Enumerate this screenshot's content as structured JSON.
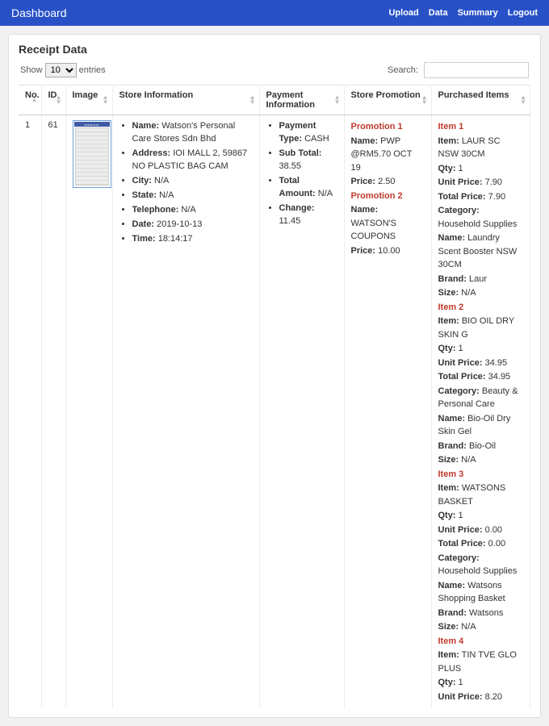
{
  "navbar": {
    "brand": "Dashboard",
    "menu": [
      "Upload",
      "Data",
      "Summary",
      "Logout"
    ]
  },
  "section_title": "Receipt Data",
  "table_controls": {
    "show_label_pre": "Show",
    "show_label_post": "entries",
    "show_value": "10",
    "search_label": "Search:"
  },
  "columns": {
    "no": "No.",
    "id": "ID",
    "image": "Image",
    "store": "Store Information",
    "payment": "Payment Information",
    "promo": "Store Promotion",
    "items": "Purchased Items"
  },
  "row": {
    "no": "1",
    "id": "61",
    "store": {
      "name_label": "Name:",
      "name": "Watson's Personal Care Stores Sdn Bhd",
      "address_label": "Address:",
      "address": "IOI MALL 2, 59867 NO PLASTIC BAG CAM",
      "city_label": "City:",
      "city": "N/A",
      "state_label": "State:",
      "state": "N/A",
      "telephone_label": "Telephone:",
      "telephone": "N/A",
      "date_label": "Date:",
      "date": "2019-10-13",
      "time_label": "Time:",
      "time": "18:14:17"
    },
    "payment": {
      "type_label": "Payment Type:",
      "type": "CASH",
      "subtotal_label": "Sub Total:",
      "subtotal": "38.55",
      "total_label": "Total Amount:",
      "total": "N/A",
      "change_label": "Change:",
      "change": "11.45"
    },
    "promos": [
      {
        "title": "Promotion 1",
        "name_label": "Name:",
        "name": "PWP @RM5.70 OCT 19",
        "price_label": "Price:",
        "price": "2.50"
      },
      {
        "title": "Promotion 2",
        "name_label": "Name:",
        "name": "WATSON'S COUPONS",
        "price_label": "Price:",
        "price": "10.00"
      }
    ],
    "items": [
      {
        "title": "Item 1",
        "item_label": "Item:",
        "item": "LAUR SC NSW 30CM",
        "qty_label": "Qty:",
        "qty": "1",
        "unit_label": "Unit Price:",
        "unit": "7.90",
        "tprice_label": "Total Price:",
        "tprice": "7.90",
        "cat_label": "Category:",
        "cat": "Household Supplies",
        "name_label": "Name:",
        "name": "Laundry Scent Booster NSW 30CM",
        "brand_label": "Brand:",
        "brand": "Laur",
        "size_label": "Size:",
        "size": "N/A"
      },
      {
        "title": "Item 2",
        "item_label": "Item:",
        "item": "BIO OIL DRY SKIN G",
        "qty_label": "Qty:",
        "qty": "1",
        "unit_label": "Unit Price:",
        "unit": "34.95",
        "tprice_label": "Total Price:",
        "tprice": "34.95",
        "cat_label": "Category:",
        "cat": "Beauty & Personal Care",
        "name_label": "Name:",
        "name": "Bio-Oil Dry Skin Gel",
        "brand_label": "Brand:",
        "brand": "Bio-Oil",
        "size_label": "Size:",
        "size": "N/A"
      },
      {
        "title": "Item 3",
        "item_label": "Item:",
        "item": "WATSONS BASKET",
        "qty_label": "Qty:",
        "qty": "1",
        "unit_label": "Unit Price:",
        "unit": "0.00",
        "tprice_label": "Total Price:",
        "tprice": "0.00",
        "cat_label": "Category:",
        "cat": "Household Supplies",
        "name_label": "Name:",
        "name": "Watsons Shopping Basket",
        "brand_label": "Brand:",
        "brand": "Watsons",
        "size_label": "Size:",
        "size": "N/A"
      },
      {
        "title": "Item 4",
        "item_label": "Item:",
        "item": "TIN TVE GLO PLUS",
        "qty_label": "Qty:",
        "qty": "1",
        "unit_label": "Unit Price:",
        "unit": "8.20"
      }
    ]
  }
}
